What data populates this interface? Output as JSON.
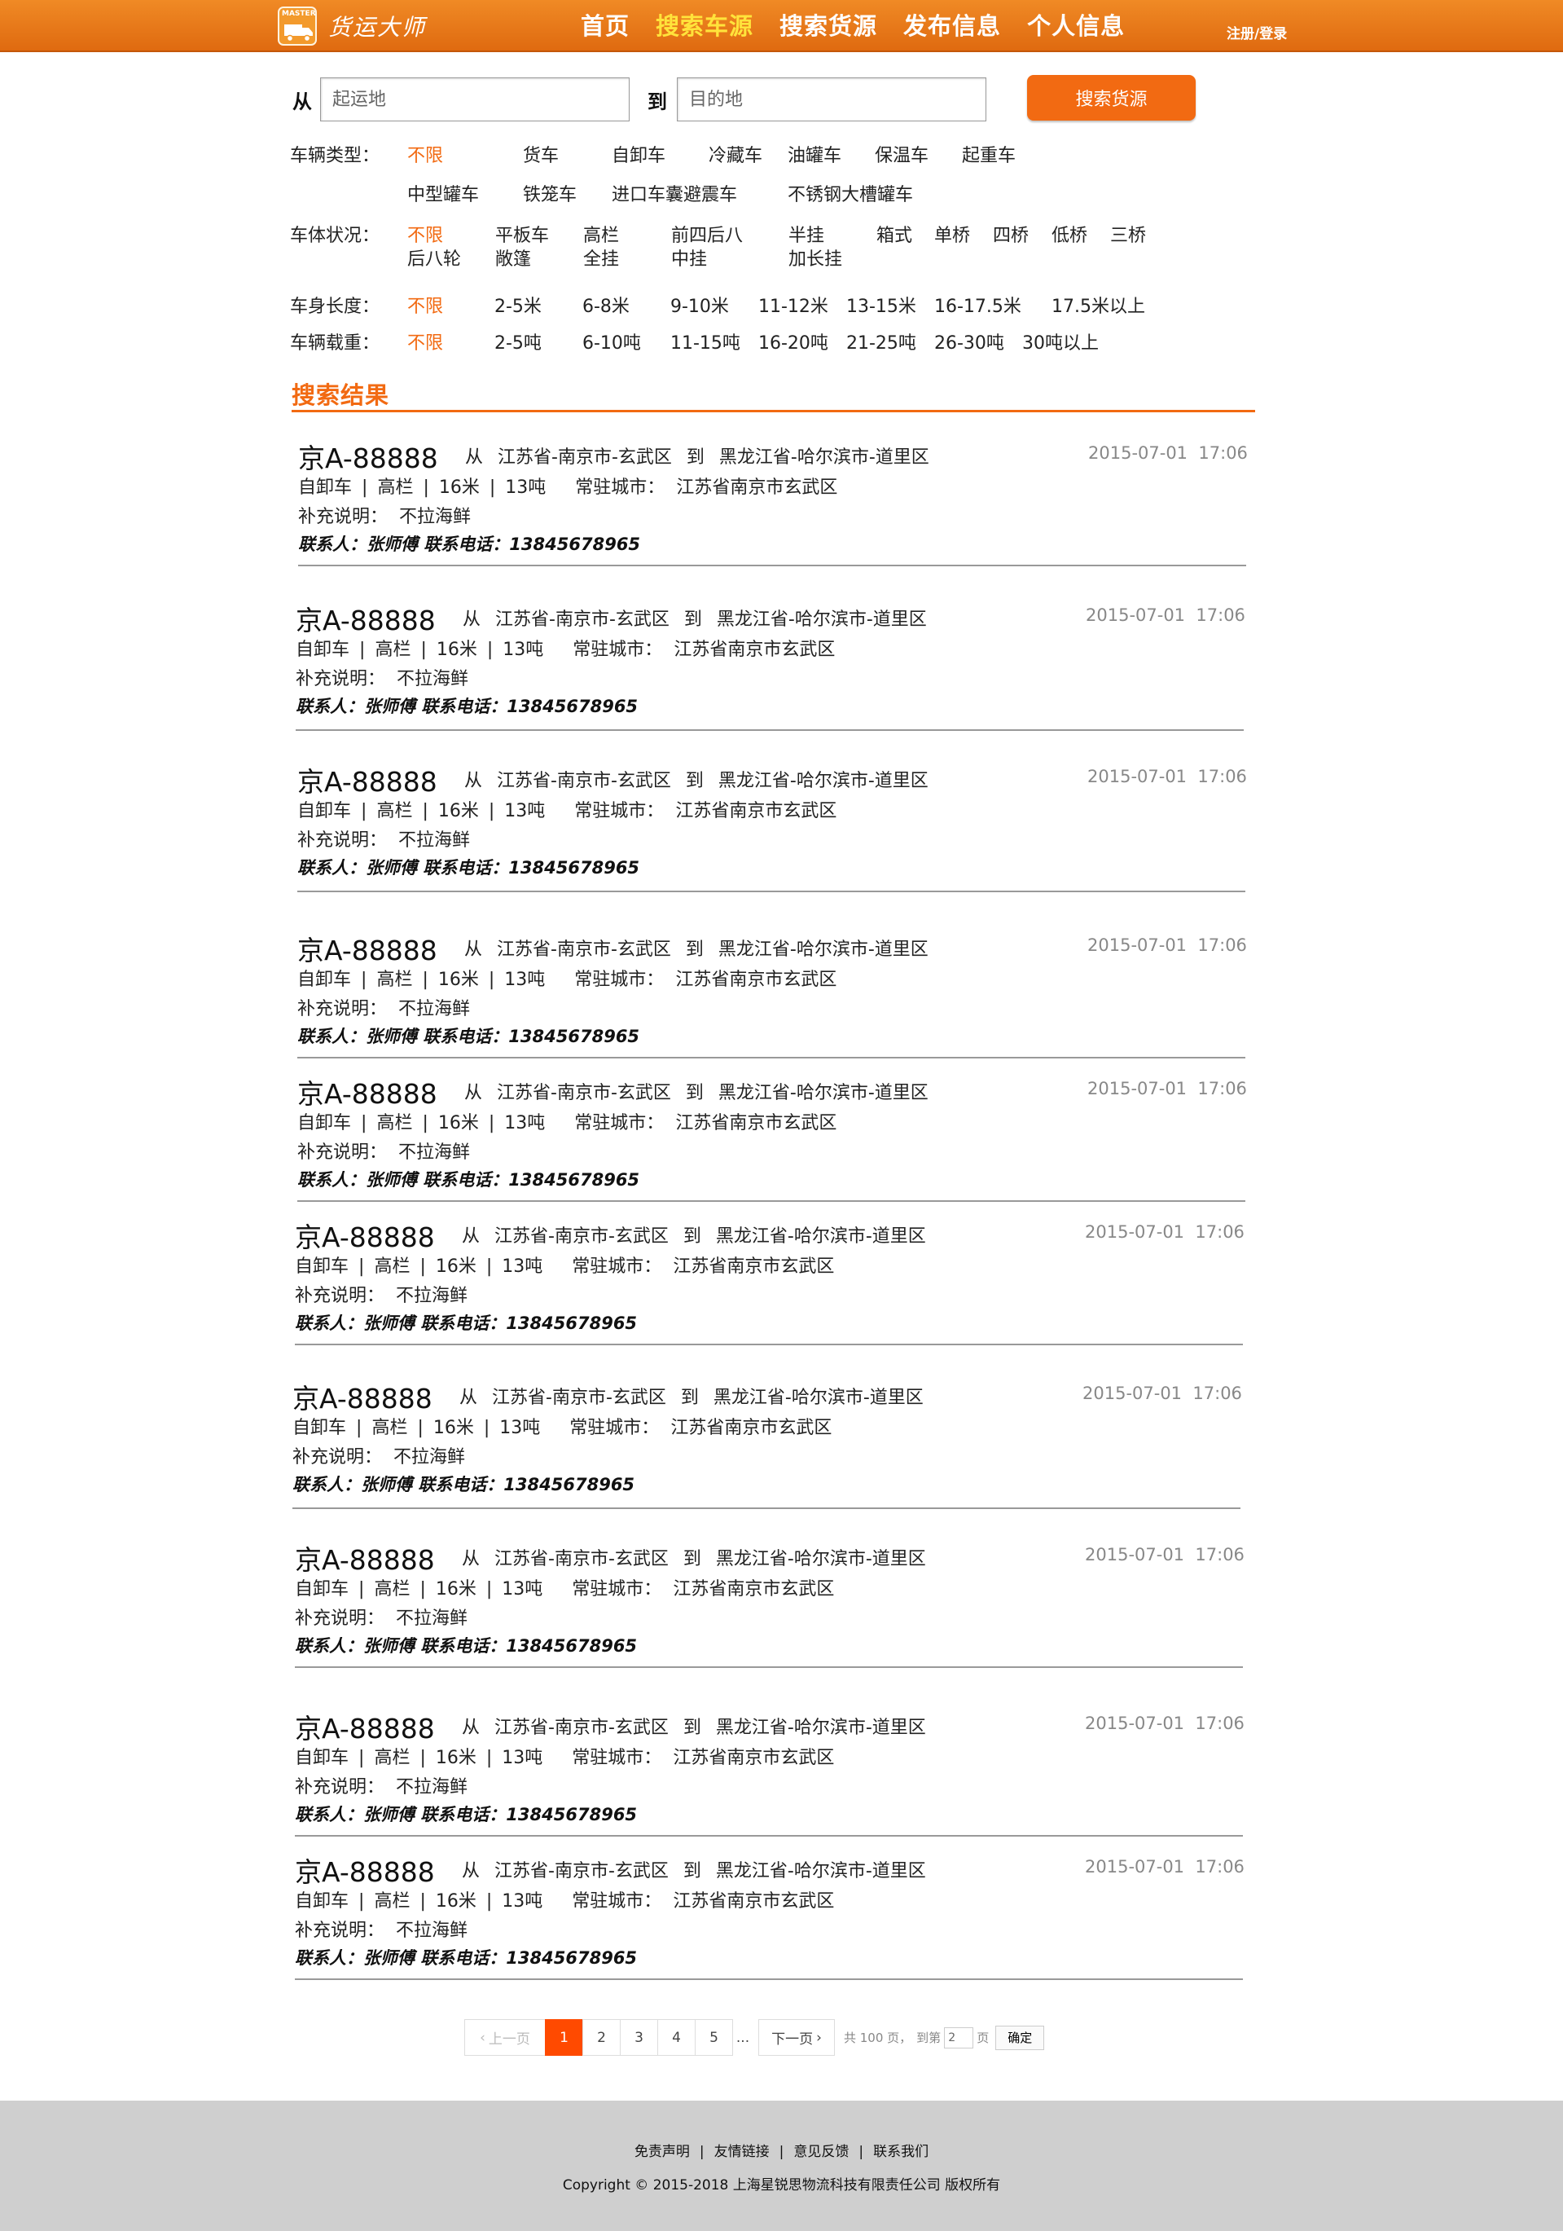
{
  "header": {
    "logo_tag": "MASTER",
    "logo_text": "货运大师",
    "nav": [
      {
        "label": "首页",
        "active": false
      },
      {
        "label": "搜索车源",
        "active": true
      },
      {
        "label": "搜索货源",
        "active": false
      },
      {
        "label": "发布信息",
        "active": false
      },
      {
        "label": "个人信息",
        "active": false
      }
    ],
    "login": "注册/登录"
  },
  "search": {
    "from_label": "从",
    "from_placeholder": "起运地",
    "to_label": "到",
    "to_placeholder": "目的地",
    "button": "搜索货源"
  },
  "filters": {
    "vehicle_type": {
      "label": "车辆类型：",
      "row1": [
        "不限",
        "货车",
        "自卸车",
        "冷藏车",
        "油罐车",
        "保温车",
        "起重车"
      ],
      "row2": [
        "中型罐车",
        "铁笼车",
        "进口车囊避震车",
        "不锈钢大槽罐车"
      ]
    },
    "body": {
      "label": "车体状况：",
      "row1": [
        "不限",
        "平板车",
        "高栏",
        "前四后八",
        "半挂",
        "箱式",
        "单桥",
        "四桥",
        "低桥",
        "三桥"
      ],
      "row2": [
        "后八轮",
        "敞篷",
        "全挂",
        "中挂",
        "加长挂"
      ]
    },
    "length": {
      "label": "车身长度：",
      "options": [
        "不限",
        "2-5米",
        "6-8米",
        "9-10米",
        "11-12米",
        "13-15米",
        "16-17.5米",
        "17.5米以上"
      ]
    },
    "weight": {
      "label": "车辆载重：",
      "options": [
        "不限",
        "2-5吨",
        "6-10吨",
        "11-15吨",
        "16-20吨",
        "21-25吨",
        "26-30吨",
        "30吨以上"
      ]
    }
  },
  "results": {
    "title": "搜索结果",
    "items": [
      {
        "plate": "京A-88888",
        "from_word": "从",
        "from": "江苏省-南京市-玄武区",
        "to_word": "到",
        "to": "黑龙江省-哈尔滨市-道里区",
        "time": "2015-07-01  17:06",
        "type": "自卸车",
        "body": "高栏",
        "length": "16米",
        "weight": "13吨",
        "city_label": "常驻城市：",
        "city": "江苏省南京市玄武区",
        "note_label": "补充说明：",
        "note": "不拉海鲜",
        "contact": "联系人：张师傅 联系电话：13845678965"
      },
      {
        "plate": "京A-88888",
        "from_word": "从",
        "from": "江苏省-南京市-玄武区",
        "to_word": "到",
        "to": "黑龙江省-哈尔滨市-道里区",
        "time": "2015-07-01  17:06",
        "type": "自卸车",
        "body": "高栏",
        "length": "16米",
        "weight": "13吨",
        "city_label": "常驻城市：",
        "city": "江苏省南京市玄武区",
        "note_label": "补充说明：",
        "note": "不拉海鲜",
        "contact": "联系人：张师傅 联系电话：13845678965"
      },
      {
        "plate": "京A-88888",
        "from_word": "从",
        "from": "江苏省-南京市-玄武区",
        "to_word": "到",
        "to": "黑龙江省-哈尔滨市-道里区",
        "time": "2015-07-01  17:06",
        "type": "自卸车",
        "body": "高栏",
        "length": "16米",
        "weight": "13吨",
        "city_label": "常驻城市：",
        "city": "江苏省南京市玄武区",
        "note_label": "补充说明：",
        "note": "不拉海鲜",
        "contact": "联系人：张师傅 联系电话：13845678965"
      },
      {
        "plate": "京A-88888",
        "from_word": "从",
        "from": "江苏省-南京市-玄武区",
        "to_word": "到",
        "to": "黑龙江省-哈尔滨市-道里区",
        "time": "2015-07-01  17:06",
        "type": "自卸车",
        "body": "高栏",
        "length": "16米",
        "weight": "13吨",
        "city_label": "常驻城市：",
        "city": "江苏省南京市玄武区",
        "note_label": "补充说明：",
        "note": "不拉海鲜",
        "contact": "联系人：张师傅 联系电话：13845678965"
      },
      {
        "plate": "京A-88888",
        "from_word": "从",
        "from": "江苏省-南京市-玄武区",
        "to_word": "到",
        "to": "黑龙江省-哈尔滨市-道里区",
        "time": "2015-07-01  17:06",
        "type": "自卸车",
        "body": "高栏",
        "length": "16米",
        "weight": "13吨",
        "city_label": "常驻城市：",
        "city": "江苏省南京市玄武区",
        "note_label": "补充说明：",
        "note": "不拉海鲜",
        "contact": "联系人：张师傅 联系电话：13845678965"
      },
      {
        "plate": "京A-88888",
        "from_word": "从",
        "from": "江苏省-南京市-玄武区",
        "to_word": "到",
        "to": "黑龙江省-哈尔滨市-道里区",
        "time": "2015-07-01  17:06",
        "type": "自卸车",
        "body": "高栏",
        "length": "16米",
        "weight": "13吨",
        "city_label": "常驻城市：",
        "city": "江苏省南京市玄武区",
        "note_label": "补充说明：",
        "note": "不拉海鲜",
        "contact": "联系人：张师傅 联系电话：13845678965"
      },
      {
        "plate": "京A-88888",
        "from_word": "从",
        "from": "江苏省-南京市-玄武区",
        "to_word": "到",
        "to": "黑龙江省-哈尔滨市-道里区",
        "time": "2015-07-01  17:06",
        "type": "自卸车",
        "body": "高栏",
        "length": "16米",
        "weight": "13吨",
        "city_label": "常驻城市：",
        "city": "江苏省南京市玄武区",
        "note_label": "补充说明：",
        "note": "不拉海鲜",
        "contact": "联系人：张师傅 联系电话：13845678965"
      },
      {
        "plate": "京A-88888",
        "from_word": "从",
        "from": "江苏省-南京市-玄武区",
        "to_word": "到",
        "to": "黑龙江省-哈尔滨市-道里区",
        "time": "2015-07-01  17:06",
        "type": "自卸车",
        "body": "高栏",
        "length": "16米",
        "weight": "13吨",
        "city_label": "常驻城市：",
        "city": "江苏省南京市玄武区",
        "note_label": "补充说明：",
        "note": "不拉海鲜",
        "contact": "联系人：张师傅 联系电话：13845678965"
      },
      {
        "plate": "京A-88888",
        "from_word": "从",
        "from": "江苏省-南京市-玄武区",
        "to_word": "到",
        "to": "黑龙江省-哈尔滨市-道里区",
        "time": "2015-07-01  17:06",
        "type": "自卸车",
        "body": "高栏",
        "length": "16米",
        "weight": "13吨",
        "city_label": "常驻城市：",
        "city": "江苏省南京市玄武区",
        "note_label": "补充说明：",
        "note": "不拉海鲜",
        "contact": "联系人：张师傅 联系电话：13845678965"
      },
      {
        "plate": "京A-88888",
        "from_word": "从",
        "from": "江苏省-南京市-玄武区",
        "to_word": "到",
        "to": "黑龙江省-哈尔滨市-道里区",
        "time": "2015-07-01  17:06",
        "type": "自卸车",
        "body": "高栏",
        "length": "16米",
        "weight": "13吨",
        "city_label": "常驻城市：",
        "city": "江苏省南京市玄武区",
        "note_label": "补充说明：",
        "note": "不拉海鲜",
        "contact": "联系人：张师傅 联系电话：13845678965"
      }
    ]
  },
  "pagination": {
    "prev": "上一页",
    "pages": [
      "1",
      "2",
      "3",
      "4",
      "5"
    ],
    "current": "1",
    "ellipsis": "...",
    "next": "下一页",
    "total": "共 100 页，",
    "goto_prefix": "到第",
    "goto_value": "2",
    "goto_suffix": "页",
    "confirm": "确定"
  },
  "footer": {
    "links": [
      "免责声明",
      "友情链接",
      "意见反馈",
      "联系我们"
    ],
    "copyright": "Copyright © 2015-2018 上海星锐思物流科技有限责任公司 版权所有"
  },
  "colors": {
    "accent": "#f26a12",
    "header": "#e8781a",
    "nav_active": "#ffe33b",
    "footer_bg": "#cfcfcf"
  }
}
